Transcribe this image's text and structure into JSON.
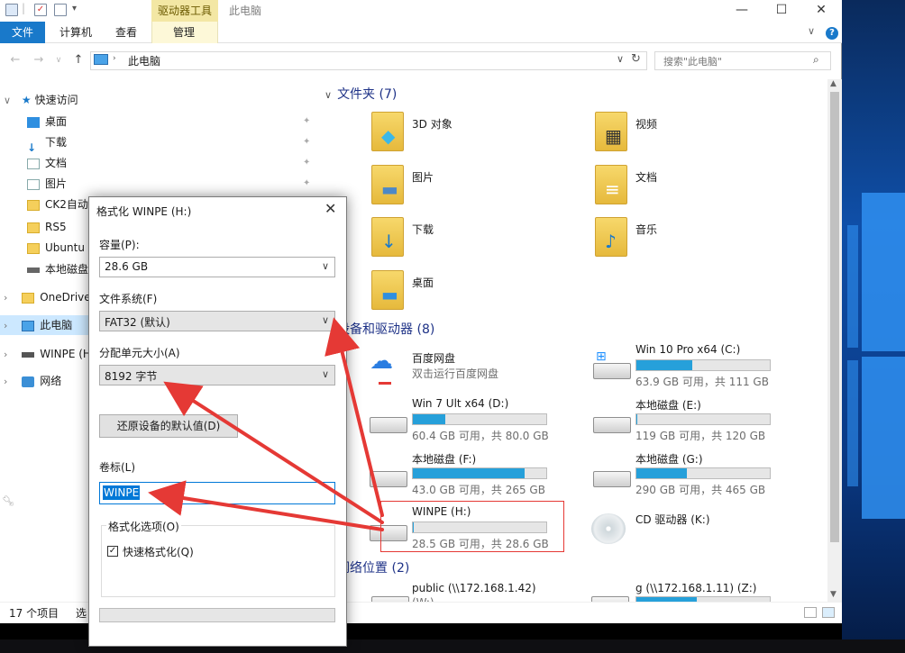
{
  "titlebar": {
    "drive_tools": "驱动器工具",
    "title": "此电脑"
  },
  "ribbon": {
    "tabs": [
      "文件",
      "计算机",
      "查看",
      "管理"
    ]
  },
  "address": {
    "path": "此电脑",
    "search_placeholder": "搜索\"此电脑\""
  },
  "nav": {
    "quick_access": "快速访问",
    "items": [
      {
        "label": "桌面",
        "icon": "desktop-icon",
        "pinned": true
      },
      {
        "label": "下载",
        "icon": "download-icon",
        "pinned": true
      },
      {
        "label": "文档",
        "icon": "document-icon",
        "pinned": true
      },
      {
        "label": "图片",
        "icon": "picture-icon",
        "pinned": true
      },
      {
        "label": "CK2自动",
        "icon": "folder-icon",
        "pinned": false
      },
      {
        "label": "RS5",
        "icon": "folder-icon",
        "pinned": false
      },
      {
        "label": "Ubuntu",
        "icon": "folder-icon",
        "pinned": false
      },
      {
        "label": "本地磁盘",
        "icon": "drive-icon",
        "pinned": false
      }
    ],
    "onedrive": "OneDrive",
    "this_pc": "此电脑",
    "winpe": "WINPE (H",
    "network": "网络"
  },
  "content": {
    "folders_header": "文件夹 (7)",
    "folders": [
      "3D 对象",
      "视频",
      "图片",
      "文档",
      "下载",
      "音乐",
      "桌面"
    ],
    "devices_header": "设备和驱动器 (8)",
    "drives": [
      {
        "name": "百度网盘",
        "sub": "双击运行百度网盘"
      },
      {
        "name": "Win 10 Pro x64 (C:)",
        "sub": "63.9 GB 可用，共 111 GB",
        "fill": 0.42
      },
      {
        "name": "Win 7 Ult x64 (D:)",
        "sub": "60.4 GB 可用，共 80.0 GB",
        "fill": 0.24
      },
      {
        "name": "本地磁盘 (E:)",
        "sub": "119 GB 可用，共 120 GB",
        "fill": 0.01
      },
      {
        "name": "本地磁盘 (F:)",
        "sub": "43.0 GB 可用，共 265 GB",
        "fill": 0.84
      },
      {
        "name": "本地磁盘 (G:)",
        "sub": "290 GB 可用，共 465 GB",
        "fill": 0.38
      },
      {
        "name": "WINPE (H:)",
        "sub": "28.5 GB 可用，共 28.6 GB",
        "fill": 0.004
      },
      {
        "name": "CD 驱动器 (K:)",
        "sub": ""
      }
    ],
    "network_header": "网络位置 (2)",
    "network": [
      {
        "name": "public (\\\\172.168.1.42)",
        "sub": "(W:)"
      },
      {
        "name": "g (\\\\172.168.1.11) (Z:)",
        "sub": ""
      }
    ]
  },
  "status": {
    "count": "17 个项目",
    "selected": "选"
  },
  "dialog": {
    "title": "格式化 WINPE (H:)",
    "capacity_label": "容量(P):",
    "capacity_value": "28.6 GB",
    "fs_label": "文件系统(F)",
    "fs_value": "FAT32 (默认)",
    "alloc_label": "分配单元大小(A)",
    "alloc_value": "8192 字节",
    "restore_button": "还原设备的默认值(D)",
    "volume_label": "卷标(L)",
    "volume_value": "WINPE",
    "format_options": "格式化选项(O)",
    "quick_format": "快速格式化(Q)",
    "quick_format_checked": true
  },
  "colors": {
    "accent": "#1979ca",
    "drive_bar": "#26a0da",
    "annotation": "#e53935"
  }
}
